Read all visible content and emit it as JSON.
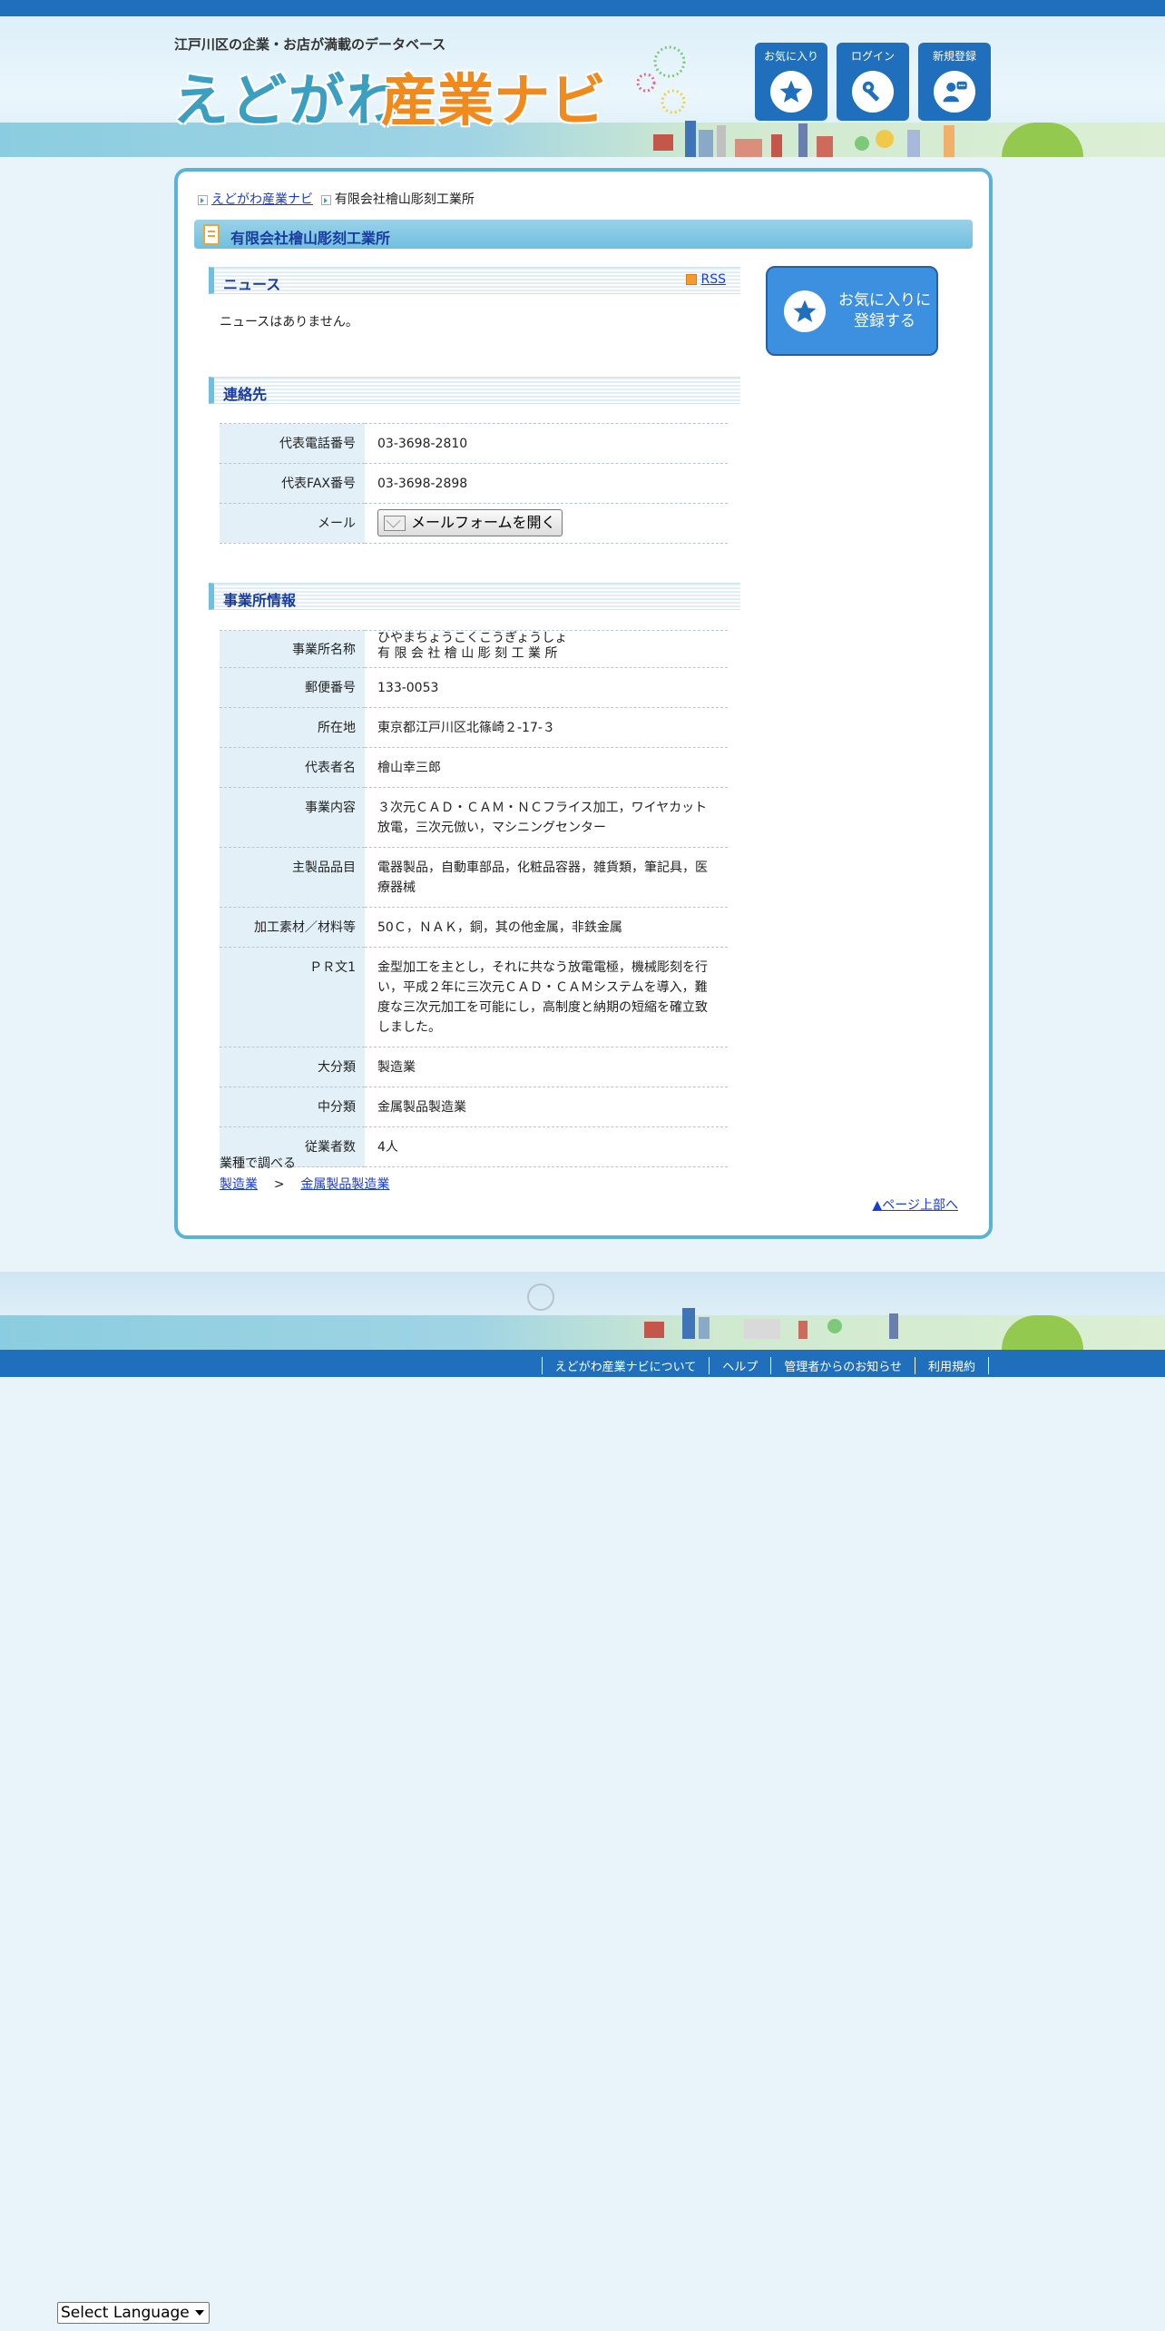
{
  "header": {
    "tagline": "江戸川区の企業・お店が満載のデータベース",
    "logo_hira": "えどがわ",
    "logo_kanji": "産業ナビ",
    "buttons": [
      {
        "label": "お気に入り",
        "icon": "star-icon"
      },
      {
        "label": "ログイン",
        "icon": "key-icon"
      },
      {
        "label": "新規登録",
        "icon": "user-add-icon"
      }
    ]
  },
  "breadcrumb": {
    "home": "えどがわ産業ナビ",
    "current": "有限会社檜山彫刻工業所"
  },
  "page_title": "有限会社檜山彫刻工業所",
  "news": {
    "heading": "ニュース",
    "rss_label": "RSS",
    "empty_text": "ニュースはありません。"
  },
  "contact": {
    "heading": "連絡先",
    "rows": [
      {
        "label": "代表電話番号",
        "value": "03-3698-2810"
      },
      {
        "label": "代表FAX番号",
        "value": "03-3698-2898"
      },
      {
        "label": "メール",
        "button": "メールフォームを開く"
      }
    ]
  },
  "office": {
    "heading": "事業所情報",
    "name_label": "事業所名称",
    "name_ruby": "ひやまちょうこくこうぎょうしょ",
    "name_value": "有 限 会 社 檜 山 彫 刻 工 業 所",
    "rows": [
      {
        "label": "郵便番号",
        "value": "133-0053"
      },
      {
        "label": "所在地",
        "value": "東京都江戸川区北篠崎２-17-３"
      },
      {
        "label": "代表者名",
        "value": "檜山幸三郎"
      },
      {
        "label": "事業内容",
        "value": "３次元ＣＡＤ・ＣＡＭ・ＮＣフライス加工，ワイヤカット放電，三次元倣い，マシニングセンター"
      },
      {
        "label": "主製品品目",
        "value": "電器製品，自動車部品，化粧品容器，雑貨類，筆記具，医療器械"
      },
      {
        "label": "加工素材／材料等",
        "value": "50Ｃ，ＮＡＫ，銅，其の他金属，非鉄金属"
      },
      {
        "label": "ＰＲ文1",
        "value": "金型加工を主とし，それに共なう放電電極，機械彫刻を行い，平成２年に三次元ＣＡＤ・ＣＡＭシステムを導入，難度な三次元加工を可能にし，高制度と納期の短縮を確立致しました。"
      },
      {
        "label": "大分類",
        "value": "製造業"
      },
      {
        "label": "中分類",
        "value": "金属製品製造業"
      },
      {
        "label": "従業者数",
        "value": "4人"
      }
    ]
  },
  "industry": {
    "label": "業種で調べる",
    "major": "製造業",
    "separator": ">",
    "minor": "金属製品製造業"
  },
  "page_top": "▲ページ上部へ",
  "favorite_box": {
    "line1": "お気に入りに",
    "line2": "登録する"
  },
  "footer": {
    "links": [
      "えどがわ産業ナビについて",
      "ヘルプ",
      "管理者からのお知らせ",
      "利用規約"
    ]
  },
  "language_select": {
    "value": "Select Language"
  },
  "colors": {
    "brand_blue": "#1f6fbd",
    "frame_blue": "#5ab3d6",
    "heading_navy": "#1a3b9e",
    "logo_teal": "#3a9fc1",
    "logo_orange": "#f08a1c"
  }
}
